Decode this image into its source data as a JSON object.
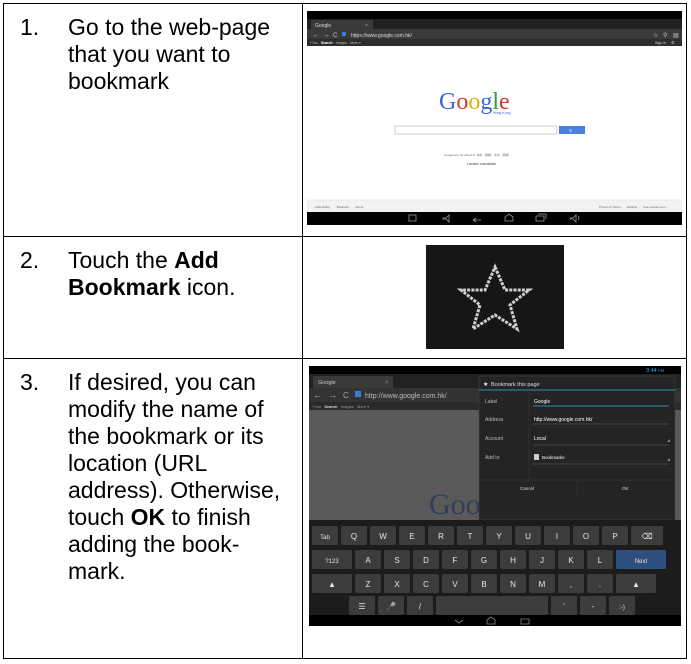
{
  "steps": [
    {
      "number": "1.",
      "text": "Go to the web-page that you want to bookmark",
      "screenshot": {
        "tab_title": "Google",
        "url": "https://www.google.com.hk/",
        "links": [
          "+You",
          "Search",
          "Images",
          "More ▾"
        ],
        "sign_in": "Sign in",
        "logo": "Google",
        "logo_sub": "Hong Kong",
        "search_btn": "🔍",
        "offered": "Google.com.hk offered in: 中文（繁體） 中文（简体）",
        "location": "Location unavailable",
        "footer_left": [
          "Advertising",
          "Business",
          "About"
        ],
        "footer_right": [
          "Privacy & Terms",
          "Settings",
          "Use Google.com"
        ]
      }
    },
    {
      "number": "2.",
      "text_pre": "Touch the ",
      "text_bold": "Add Bookmark",
      "text_post": " icon."
    },
    {
      "number": "3.",
      "text_a": "If desired, you can modify the name of the bookmark or its location (URL address). Otherwise, touch ",
      "text_bold": "OK",
      "text_b": " to finish adding the book-mark.",
      "screenshot": {
        "time": "3:44",
        "ampm": "PM",
        "tab_title": "Google",
        "url": "http://www.google.com.hk/",
        "links": [
          "+You",
          "Search",
          "Images",
          "More ▾"
        ],
        "dialog_title": "Bookmark this page",
        "fields": [
          {
            "label": "Label",
            "value": "Google"
          },
          {
            "label": "Address",
            "value": "http://www.google.com.hk/"
          },
          {
            "label": "Account",
            "value": "Local"
          },
          {
            "label": "Add to",
            "value": "Bookmarks"
          }
        ],
        "cancel": "Cancel",
        "ok": "OK",
        "keys_row1": [
          "Tab",
          "Q",
          "W",
          "E",
          "R",
          "T",
          "Y",
          "U",
          "I",
          "O",
          "P",
          "⌫"
        ],
        "keys_row2": [
          "?123",
          "A",
          "S",
          "D",
          "F",
          "G",
          "H",
          "J",
          "K",
          "L",
          "Next"
        ],
        "keys_row3": [
          "▲",
          "Z",
          "X",
          "C",
          "V",
          "B",
          "N",
          "M",
          ",",
          ".",
          "▲"
        ],
        "keys_row4": [
          "☰",
          "🎤",
          "/",
          "",
          "'",
          "-",
          ":-)"
        ]
      }
    }
  ]
}
